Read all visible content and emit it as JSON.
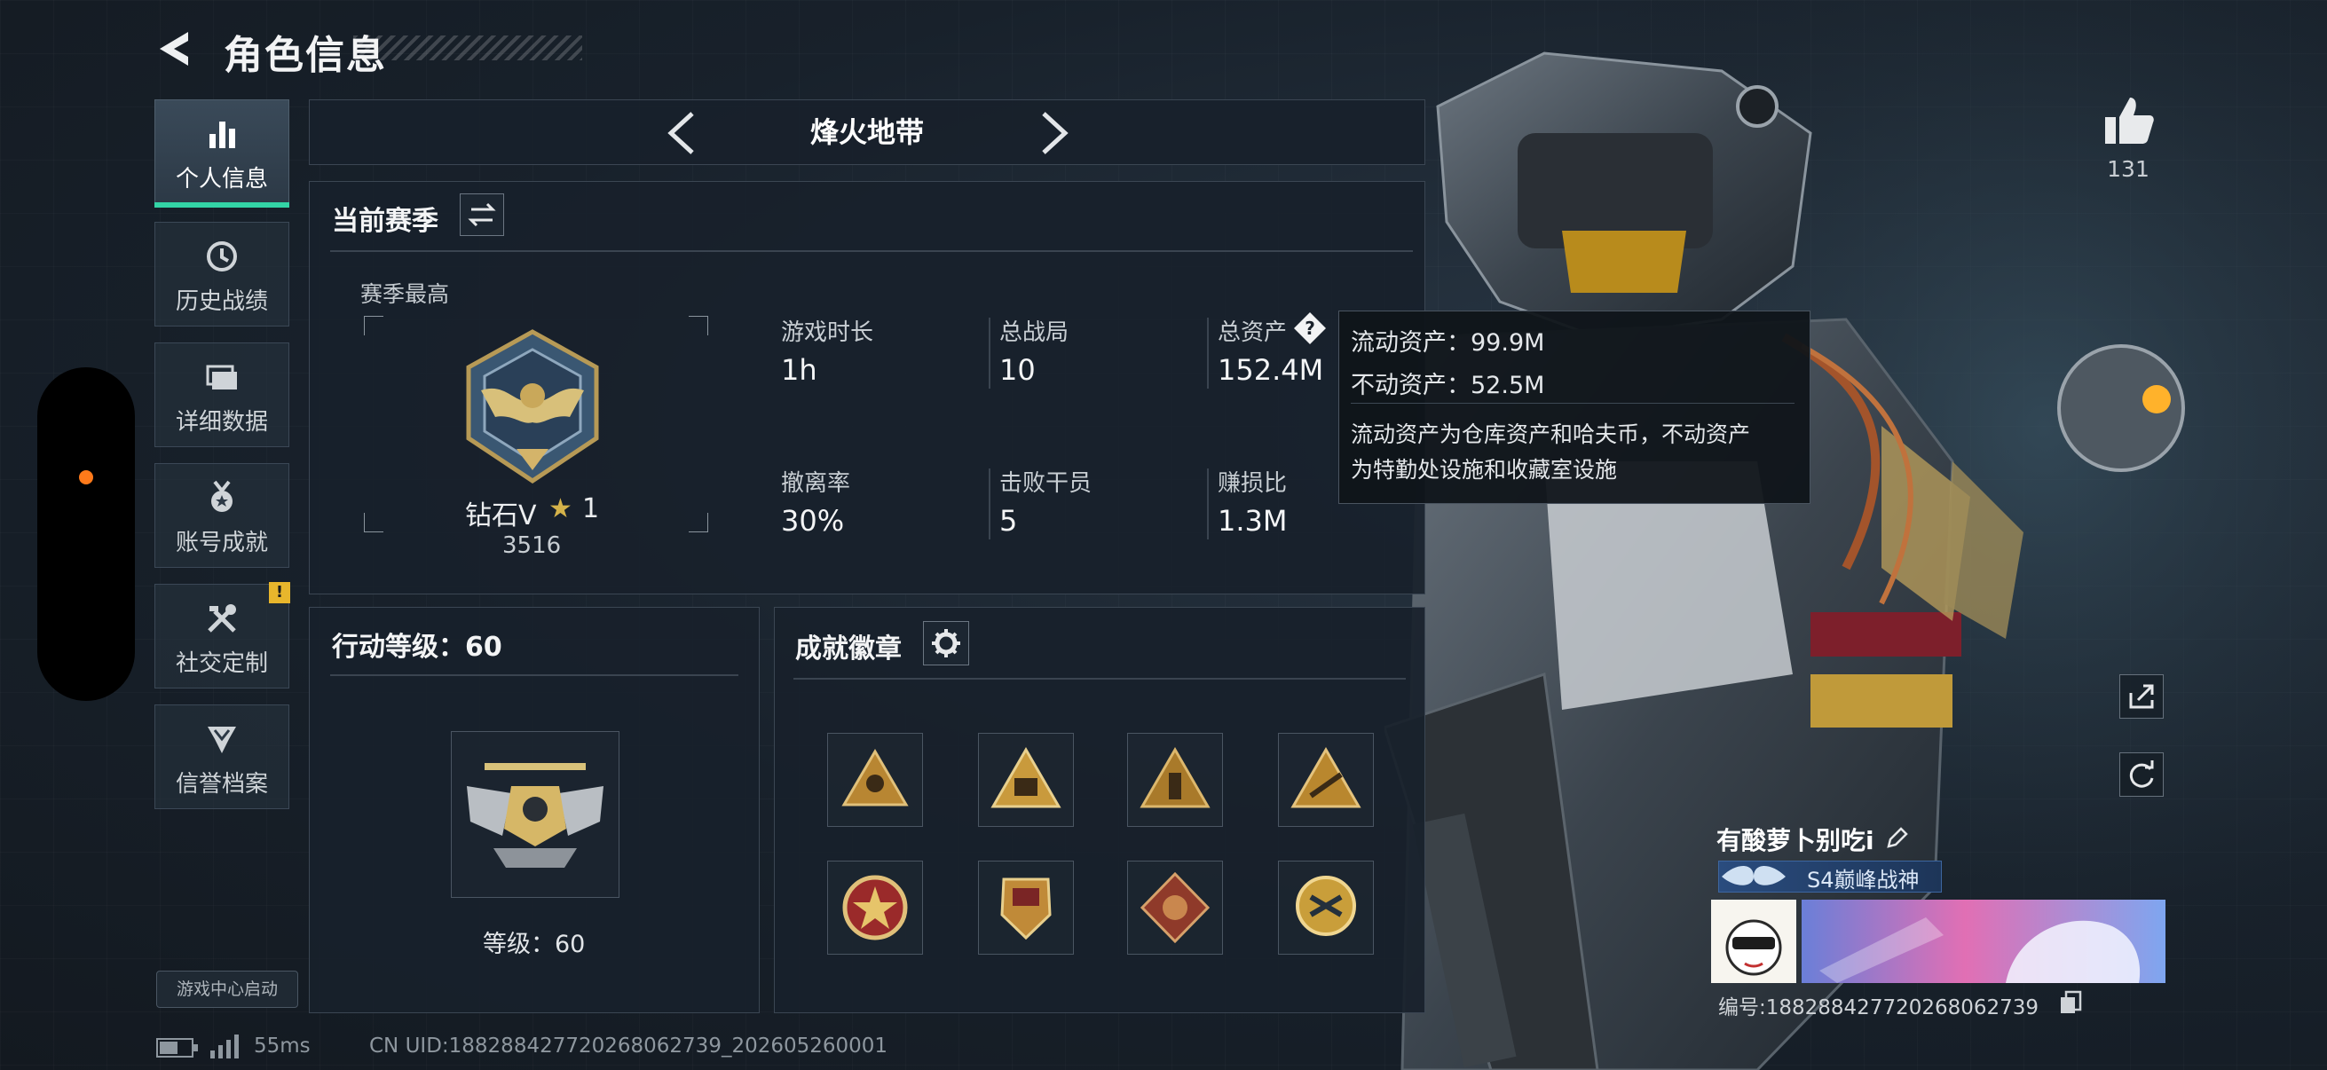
{
  "header": {
    "title": "角色信息"
  },
  "nav": {
    "items": [
      {
        "label": "个人信息",
        "icon": "bar-chart-icon",
        "active": true
      },
      {
        "label": "历史战绩",
        "icon": "history-clock-icon"
      },
      {
        "label": "详细数据",
        "icon": "folder-stack-icon"
      },
      {
        "label": "账号成就",
        "icon": "medal-icon"
      },
      {
        "label": "社交定制",
        "icon": "tools-icon",
        "badge": "!"
      },
      {
        "label": "信誉档案",
        "icon": "shield-chevron-icon"
      }
    ],
    "game_center": "游戏中心启动"
  },
  "mode": {
    "title": "烽火地带"
  },
  "season": {
    "title": "当前赛季",
    "best_label": "赛季最高",
    "rank_name": "钻石V",
    "rank_stars": "1",
    "rank_points": "3516",
    "stats": [
      {
        "label": "游戏时长",
        "value": "1h"
      },
      {
        "label": "总战局",
        "value": "10"
      },
      {
        "label": "总资产",
        "value": "152.4M"
      },
      {
        "label": "撤离率",
        "value": "30%"
      },
      {
        "label": "击败干员",
        "value": "5"
      },
      {
        "label": "赚损比",
        "value": "1.3M"
      }
    ]
  },
  "tooltip": {
    "line1": "流动资产：99.9M",
    "line2": "不动资产：52.5M",
    "desc1": "流动资产为仓库资产和哈夫币，不动资产",
    "desc2": "为特勤处设施和收藏室设施"
  },
  "action_level": {
    "title": "行动等级：60",
    "level_label": "等级：60"
  },
  "badges": {
    "title": "成就徽章",
    "items": [
      "triangle-soldier-badge",
      "triangle-s8-badge",
      "triangle-figure-badge",
      "triangle-arrow-badge",
      "red-star-badge",
      "shield-emblem-badge",
      "dragon-diamond-badge",
      "gold-shield-badge"
    ]
  },
  "footer": {
    "ping": "55ms",
    "uid": "CN UID:18828842772026806273​9_202605260001"
  },
  "profile": {
    "likes": "131",
    "player_name": "有酸萝卜别吃i",
    "title_badge": "S4巅峰战神",
    "player_id": "编号:18828842772026806273​9"
  },
  "colors": {
    "accent_green": "#33d4a6",
    "warning_yellow": "#e8b62c",
    "orange_dot": "#ff7a1a"
  }
}
